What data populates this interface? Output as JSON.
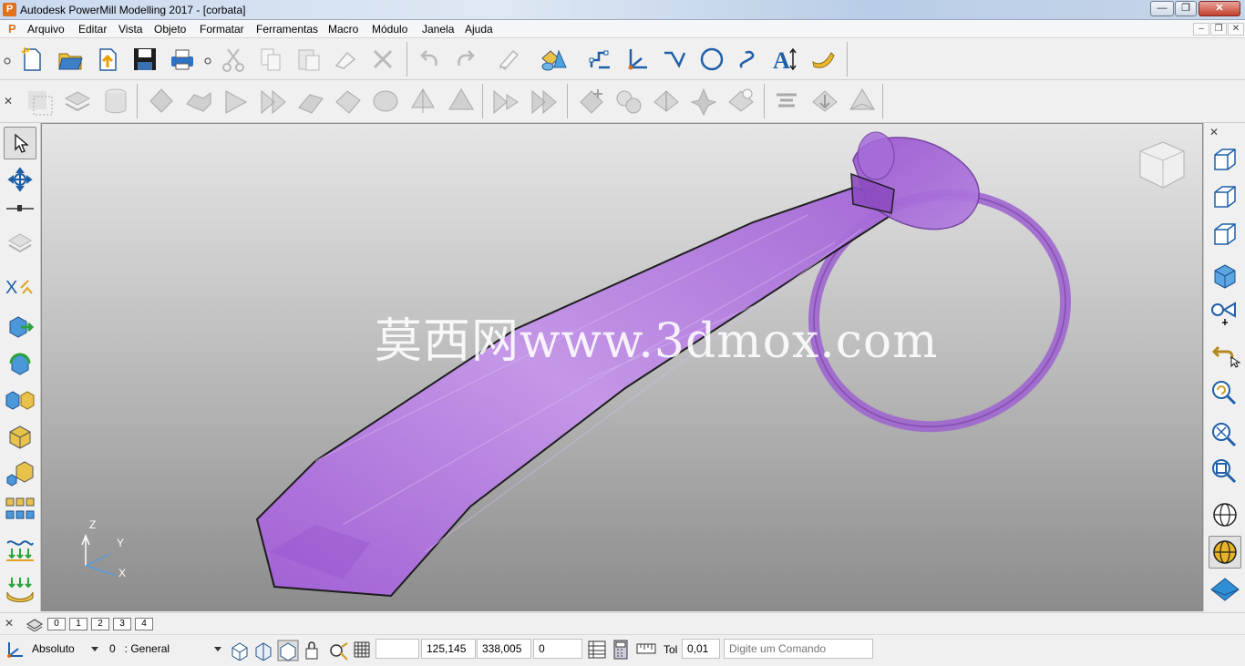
{
  "window": {
    "title": "Autodesk PowerMill Modelling 2017 - [corbata]",
    "app_icon_letter": "P",
    "min_glyph": "—",
    "max_glyph": "❐",
    "close_glyph": "✕"
  },
  "menu": {
    "logo": "P",
    "items": [
      "Arquivo",
      "Editar",
      "Vista",
      "Objeto",
      "Formatar",
      "Ferramentas",
      "Macro",
      "Módulo",
      "Janela",
      "Ajuda"
    ],
    "mdi_min": "–",
    "mdi_restore": "❐",
    "mdi_close": "✕"
  },
  "viewport": {
    "watermark": "莫西网www.3dmox.com",
    "axis_z": "Z",
    "axis_y": "Y",
    "axis_x": "X"
  },
  "layers": {
    "tabs": [
      "0",
      "1",
      "2",
      "3",
      "4"
    ]
  },
  "status": {
    "coord_mode": "Absoluto",
    "workplane": "0   : General",
    "blank_value": "",
    "coord_x": "125,145",
    "coord_y": "338,005",
    "coord_z": "0",
    "tol_label": "Tol",
    "tol_value": "0,01",
    "command_placeholder": "Digite um Comando"
  },
  "icons": {
    "toolbar1": [
      "new-model-icon",
      "open-icon",
      "import-icon",
      "save-icon",
      "print-icon",
      "cut-icon",
      "copy-icon",
      "paste-icon",
      "eraser-icon",
      "delete-icon",
      "undo-icon",
      "redo-icon",
      "edit-pencil-icon",
      "primitive-icon",
      "workplane-icon",
      "axis-icon",
      "line-icon",
      "circle-icon",
      "curve-icon",
      "text-icon",
      "surface-icon"
    ],
    "toolbar2": [
      "close-toolbar-icon",
      "select-box-icon",
      "layer-icon",
      "cylinder-icon",
      "solid-1-icon",
      "solid-2-icon",
      "solid-3-icon",
      "solid-4-icon",
      "solid-5-icon",
      "solid-6-icon",
      "sphere-icon",
      "solid-7-icon",
      "solid-8-icon",
      "solid-9-icon",
      "solid-10-icon",
      "boolean-add-icon",
      "spheres-icon",
      "split-icon",
      "star-solid-icon",
      "z-solid-icon",
      "spread-icon",
      "drop-icon",
      "cone-icon"
    ],
    "left": [
      "select-arrow-icon",
      "rotate-view-icon",
      "pin-icon",
      "plane-icon",
      "transform-icon",
      "move-icon",
      "rotate-icon",
      "mirror-icon",
      "offset-icon",
      "scale-icon",
      "pattern-icon",
      "project-icon",
      "lay-down-icon"
    ],
    "right": [
      "close-panel-icon",
      "view-iso1-icon",
      "view-iso2-icon",
      "view-iso3-icon",
      "view-solid-icon",
      "view-camera-icon",
      "undo-view-icon",
      "zoom-reset-icon",
      "zoom-fit-icon",
      "zoom-box-icon",
      "wireframe-globe-icon",
      "shaded-globe-icon",
      "plane-shade-icon"
    ]
  },
  "colors": {
    "tie_fill": "#b27ee0",
    "tie_edge": "#1a1a1a",
    "viewport_top": "#e6e6e6",
    "viewport_bottom": "#8c8c8c"
  }
}
